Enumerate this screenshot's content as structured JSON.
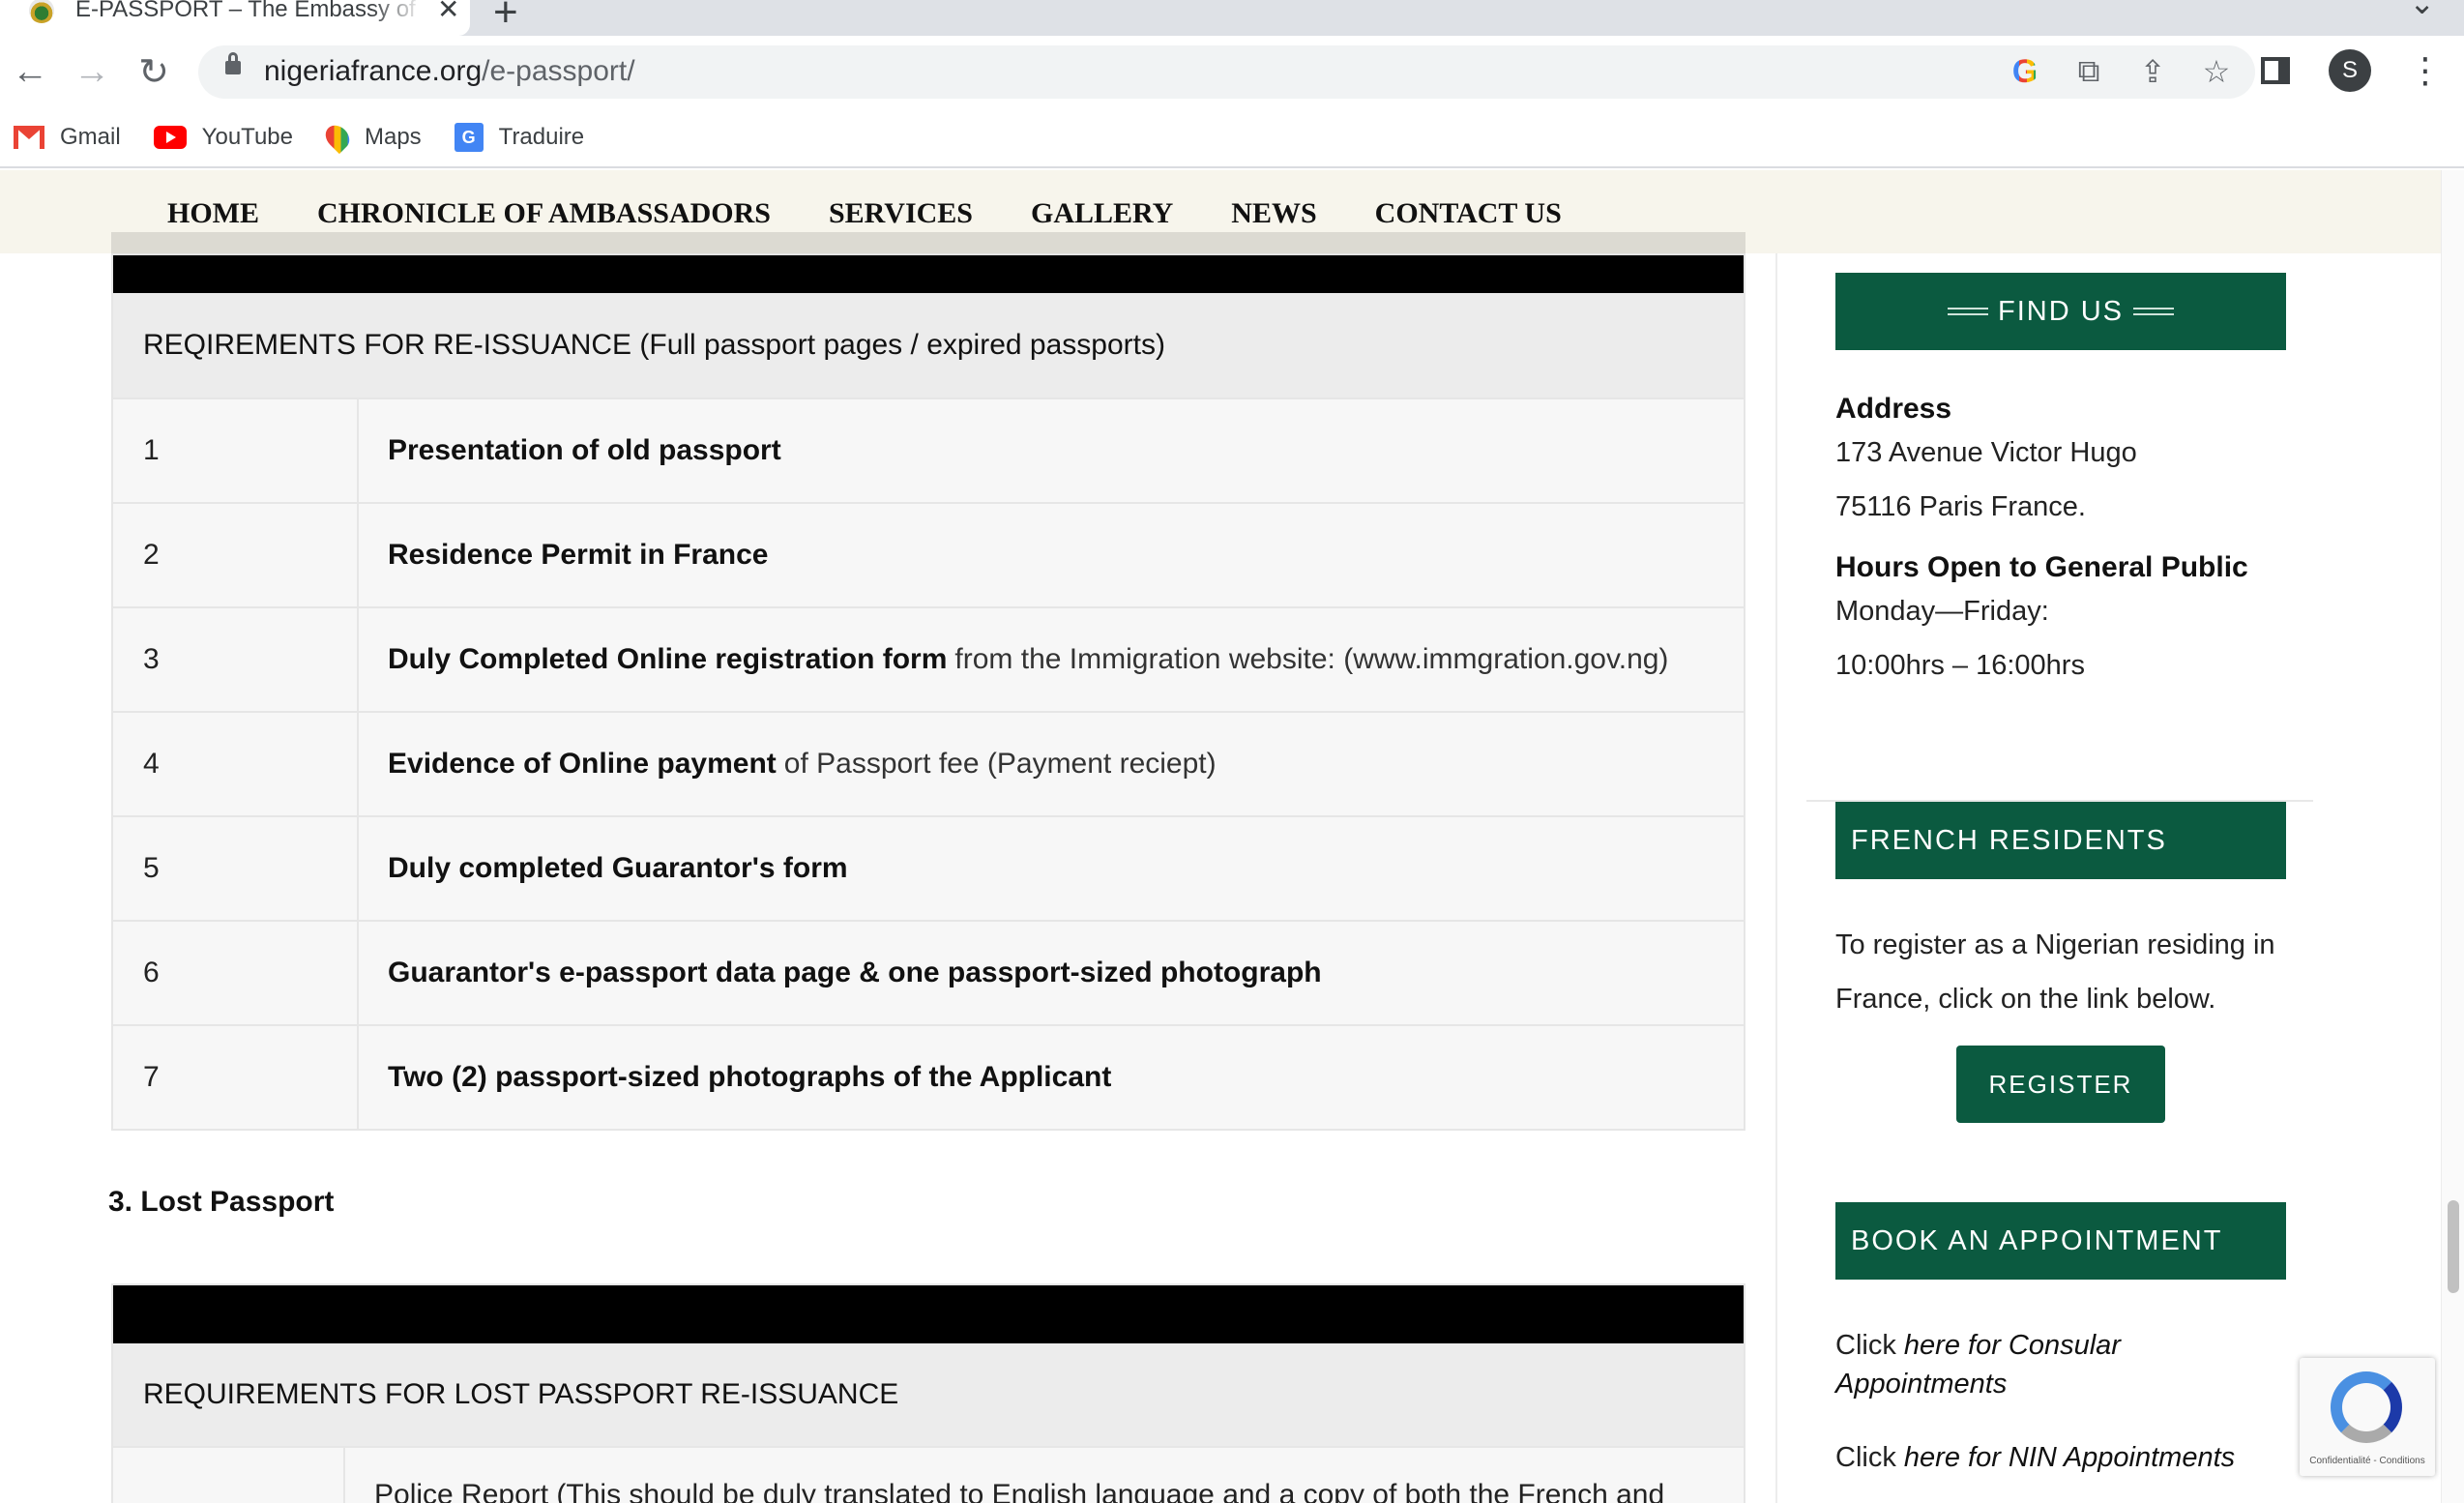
{
  "browser": {
    "tab_title": "E-PASSPORT – The Embassy of",
    "tab_close": "✕",
    "new_tab": "+",
    "url_domain": "nigeriafrance.org",
    "url_path": "/e-passport/",
    "profile_initial": "S",
    "bookmarks": [
      "Gmail",
      "YouTube",
      "Maps",
      "Traduire"
    ]
  },
  "site_nav": [
    "HOME",
    "CHRONICLE OF AMBASSADORS",
    "SERVICES",
    "GALLERY",
    "NEWS",
    "CONTACT US"
  ],
  "reissue_table": {
    "header": "REQIREMENTS FOR RE-ISSUANCE (Full passport pages / expired passports)",
    "rows": [
      {
        "num": "1",
        "bold": "Presentation of old passport",
        "rest": ""
      },
      {
        "num": "2",
        "bold": "Residence Permit in France",
        "rest": ""
      },
      {
        "num": "3",
        "bold": "Duly Completed Online registration form",
        "rest": "from the Immigration website:  (www.immgration.gov.ng)"
      },
      {
        "num": "4",
        "bold": "Evidence of Online payment",
        "rest": "of Passport fee (Payment reciept)"
      },
      {
        "num": "5",
        "bold": "Duly completed Guarantor's form",
        "rest": ""
      },
      {
        "num": "6",
        "bold": "Guarantor's e-passport data page & one passport-sized photograph",
        "rest": ""
      },
      {
        "num": "7",
        "bold": "Two (2) passport-sized photographs of the Applicant",
        "rest": ""
      }
    ]
  },
  "lost_section_title": "3. Lost Passport",
  "lost_table": {
    "header": "REQUIREMENTS FOR LOST PASSPORT RE-ISSUANCE",
    "first_row_text": "Police Report (This should be duly translated to English language and a copy of both the French and"
  },
  "sidebar": {
    "find_us_title": "FIND US",
    "address_label": "Address",
    "address_line1": "173 Avenue Victor Hugo",
    "address_line2": "75116 Paris France.",
    "hours_label": "Hours Open to General Public",
    "hours_days": "Monday—Friday:",
    "hours_time": "10:00hrs – 16:00hrs",
    "french_residents_title": "FRENCH RESIDENTS",
    "french_residents_text": "To register as a Nigerian residing in France, click on the link below.",
    "register_button": "REGISTER",
    "appointment_title": "BOOK AN APPOINTMENT",
    "appointment_link1_prefix": "Click",
    "appointment_link1": "here for Consular Appointments",
    "appointment_link2_prefix": "Click",
    "appointment_link2": "here for NIN Appointments"
  },
  "recaptcha_text": "Confidentialité - Conditions"
}
